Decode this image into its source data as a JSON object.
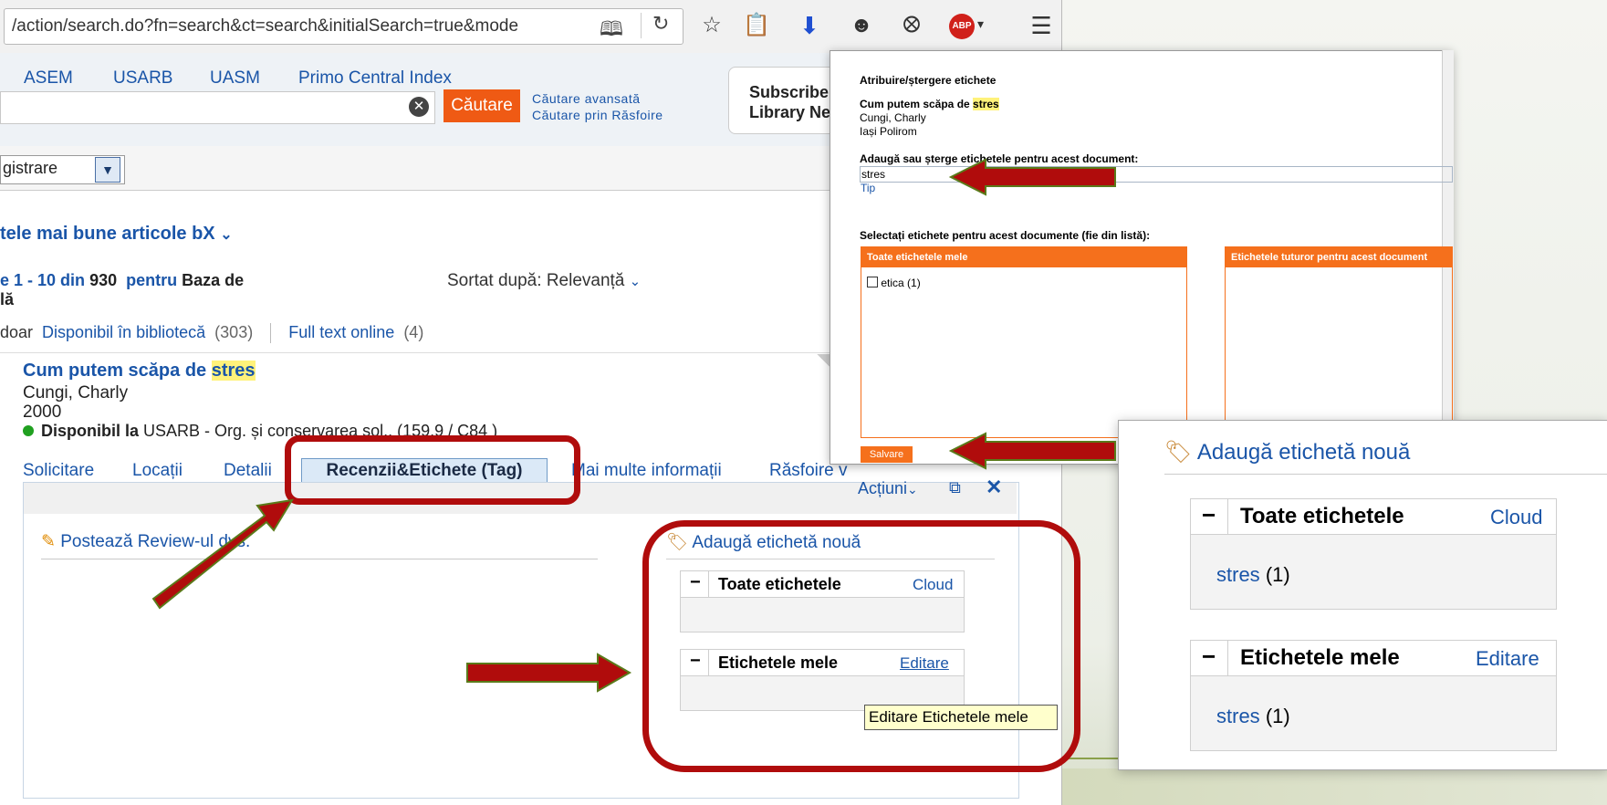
{
  "browser": {
    "url": "/action/search.do?fn=search&ct=search&initialSearch=true&mode",
    "toolbar_icons": [
      "reader-icon",
      "reload-icon",
      "bookmark-star-icon",
      "clipboard-icon",
      "download-icon",
      "chat-icon",
      "pocket-icon",
      "adblock-icon",
      "menu-icon"
    ],
    "abp_label": "ABP"
  },
  "library_tabs": [
    "ASEM",
    "USARB",
    "UASM",
    "Primo Central Index"
  ],
  "search": {
    "button_label": "Căutare",
    "advanced_link": "Căutare avansată",
    "browse_link": "Căutare prin Răsfoire"
  },
  "subscribe": {
    "line1": "Subscribe",
    "line2": "Library Ne"
  },
  "scope_select": "gistrare",
  "bx_title": "tele mai bune articole bX",
  "results": {
    "range": "e 1 - 10 din",
    "total": "930",
    "for_label": "pentru",
    "scope": "Baza de",
    "scope_line2": "lă",
    "sort_label": "Sortat după:",
    "sort_value": "Relevanță"
  },
  "filters": {
    "prefix": "doar",
    "in_library": "Disponibil în bibliotecă",
    "in_library_count": "(303)",
    "fulltext": "Full text online",
    "fulltext_count": "(4)"
  },
  "record": {
    "title_prefix": "Cum putem scăpa de",
    "title_highlight": "stres",
    "author": "Cungi, Charly",
    "year": "2000",
    "avail_label": "Disponibil la",
    "avail_value": "USARB - Org. și conservarea sol.. (159.9 / C84 )",
    "tabs": [
      "Solicitare",
      "Locații",
      "Detalii",
      "Recenzii&Etichete (Tag)",
      "Mai multe informații",
      "Răsfoire v"
    ],
    "actions": "Acțiuni",
    "post_review": "Postează Review-ul dvs.",
    "add_tag": "Adaugă etichetă nouă",
    "all_tags": "Toate etichetele",
    "cloud": "Cloud",
    "my_tags": "Etichetele mele",
    "edit": "Editare",
    "tooltip": "Editare Etichetele mele"
  },
  "dialog": {
    "title": "Atribuire/ștergere etichete",
    "doc_title_prefix": "Cum putem scăpa de",
    "doc_title_highlight": "stres",
    "doc_author": "Cungi, Charly",
    "doc_publisher": "Iași Polirom",
    "add_label": "Adaugă sau șterge etichetele pentru acest document:",
    "input_value": "stres",
    "tip": "Tip",
    "select_label": "Selectați etichete pentru acest documente (fie din listă):",
    "my_tags_header": "Toate etichetele mele",
    "my_tag_item": "etica (1)",
    "all_tags_header": "Etichetele tuturor pentru acest document",
    "save": "Salvare"
  },
  "zoom": {
    "add_tag": "Adaugă etichetă nouă",
    "all_tags": "Toate etichetele",
    "cloud": "Cloud",
    "all_tag_item": "stres",
    "all_tag_count": "(1)",
    "my_tags": "Etichetele mele",
    "edit": "Editare",
    "my_tag_item": "stres",
    "my_tag_count": "(1)"
  },
  "colors": {
    "link": "#1a55a8",
    "orange": "#f5701c",
    "annotation_red": "#b00c0c",
    "arrow_fill": "#b00c0c",
    "arrow_outline": "#5a7a1a",
    "highlight": "#fff27a"
  }
}
